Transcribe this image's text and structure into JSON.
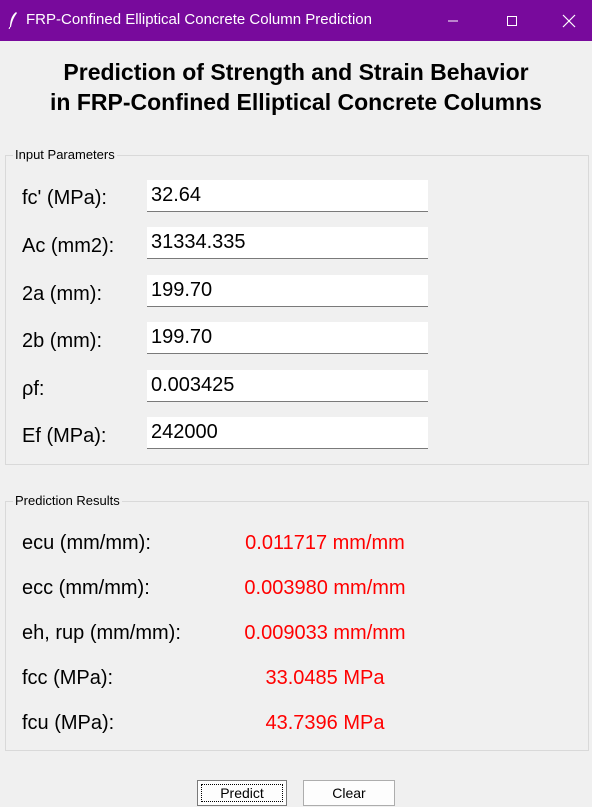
{
  "window": {
    "title": "FRP-Confined Elliptical Concrete Column Prediction",
    "titlebar_color": "#780a9c"
  },
  "heading": {
    "line1": "Prediction of Strength and Strain Behavior",
    "line2": "in FRP-Confined Elliptical Concrete Columns"
  },
  "input_group": {
    "label": "Input Parameters",
    "fields": [
      {
        "label": "fc' (MPa):",
        "value": "32.64"
      },
      {
        "label": "Ac (mm2):",
        "value": "31334.335"
      },
      {
        "label": "2a (mm):",
        "value": "199.70"
      },
      {
        "label": "2b (mm):",
        "value": "199.70"
      },
      {
        "label": "ρf:",
        "value": "0.003425"
      },
      {
        "label": "Ef (MPa):",
        "value": "242000"
      }
    ]
  },
  "results_group": {
    "label": "Prediction Results",
    "value_color": "#ff0000",
    "rows": [
      {
        "label": "ecu (mm/mm):",
        "value": "0.011717 mm/mm"
      },
      {
        "label": "ecc (mm/mm):",
        "value": "0.003980 mm/mm"
      },
      {
        "label": "eh, rup (mm/mm):",
        "value": "0.009033 mm/mm"
      },
      {
        "label": "fcc (MPa):",
        "value": "33.0485 MPa"
      },
      {
        "label": "fcu (MPa):",
        "value": "43.7396 MPa"
      }
    ]
  },
  "buttons": {
    "predict": "Predict",
    "clear": "Clear"
  }
}
